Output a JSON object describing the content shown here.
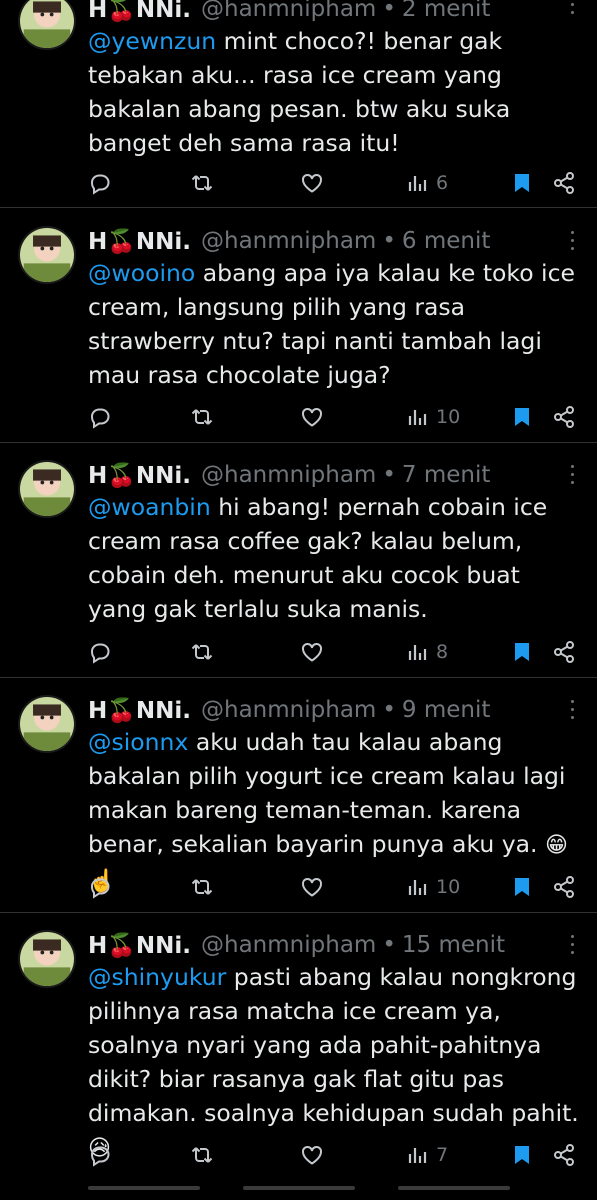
{
  "tweets": [
    {
      "name": "H🍒NNi.",
      "handle": "@hanmnipham",
      "time": "2 menit",
      "mention": "@yewnzun",
      "text": " mint choco?! benar gak tebakan aku... rasa ice cream yang bakalan abang pesan. btw aku suka banget deh sama rasa itu!",
      "emoji": "",
      "views": "6"
    },
    {
      "name": "H🍒NNi.",
      "handle": "@hanmnipham",
      "time": "6 menit",
      "mention": "@wooino",
      "text": " abang apa iya kalau ke toko ice cream, langsung pilih yang rasa strawberry ntu? tapi nanti tambah lagi mau rasa chocolate juga?",
      "emoji": "",
      "views": "10"
    },
    {
      "name": "H🍒NNi.",
      "handle": "@hanmnipham",
      "time": "7 menit",
      "mention": "@woanbin",
      "text": " hi abang! pernah cobain ice cream rasa coffee gak? kalau belum, cobain deh. menurut aku cocok buat yang gak terlalu suka manis.",
      "emoji": "",
      "views": "8"
    },
    {
      "name": "H🍒NNi.",
      "handle": "@hanmnipham",
      "time": "9 menit",
      "mention": "@sionnx",
      "text": " aku udah tau kalau abang bakalan pilih yogurt ice cream kalau lagi makan bareng teman-teman. karena benar, sekalian bayarin punya aku ya.",
      "emoji": "😁☝️",
      "views": "10"
    },
    {
      "name": "H🍒NNi.",
      "handle": "@hanmnipham",
      "time": "15 menit",
      "mention": "@shinyukur",
      "text": " pasti abang kalau nongkrong pilihnya rasa matcha ice cream ya, soalnya nyari yang ada pahit-pahitnya dikit? biar rasanya gak flat gitu pas dimakan. soalnya kehidupan sudah pahit.",
      "emoji": "😥",
      "views": "7"
    }
  ],
  "colors": {
    "mention": "#1d9bf0",
    "bookmark_active": "#1d9bf0",
    "muted": "#71767b"
  },
  "icons": [
    "reply-icon",
    "retweet-icon",
    "like-icon",
    "views-icon",
    "bookmark-icon",
    "share-icon",
    "more-icon"
  ]
}
